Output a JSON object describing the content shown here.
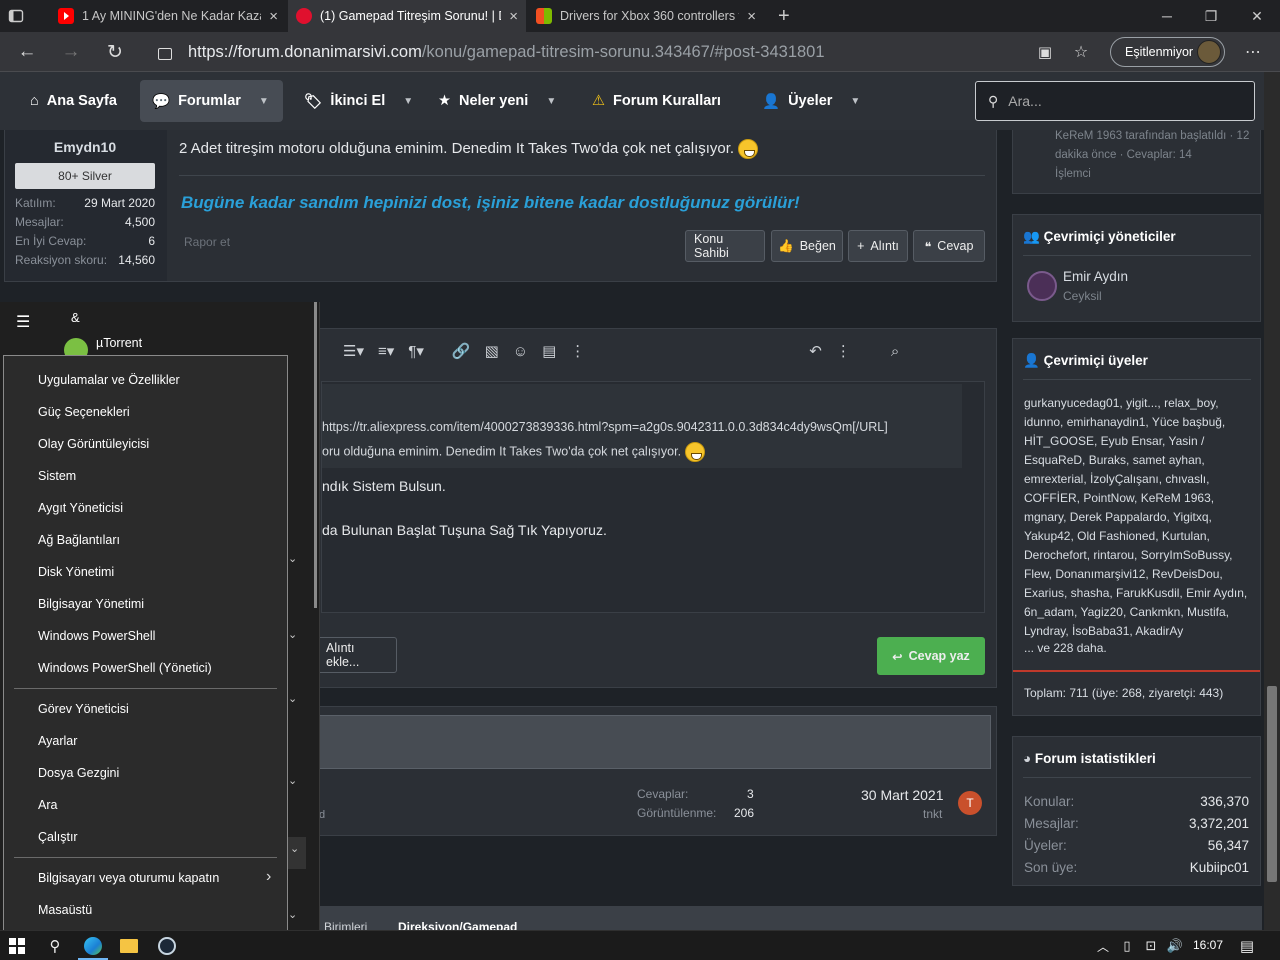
{
  "tabs": [
    {
      "title": "1 Ay MINING'den Ne Kadar Kaza",
      "close": "×",
      "favicon": "#ff0000"
    },
    {
      "title": "(1) Gamepad Titreşim Sorunu! | D",
      "close": "×",
      "favicon": "#e0102e"
    },
    {
      "title": "Drivers for Xbox 360 controllers f",
      "close": "×",
      "favicon": "#00a4ef"
    }
  ],
  "new_tab": "+",
  "window": {
    "minimize": "─",
    "maximize": "❐",
    "close": "✕"
  },
  "address": {
    "host": "https://forum.donanimarsivi.com",
    "path": "/konu/gamepad-titresim-sorunu.343467/#post-3431801",
    "sync_label": "Eşitlenmiyor"
  },
  "nav": {
    "home": "Ana Sayfa",
    "forums": "Forumlar",
    "second_hand": "İkinci El",
    "whats_new": "Neler yeni",
    "rules": "Forum Kuralları",
    "members": "Üyeler",
    "search_placeholder": "Ara..."
  },
  "post": {
    "author": "Emydn10",
    "badge": "80+ Silver",
    "stats": [
      {
        "k": "Katılım:",
        "v": "29 Mart 2020"
      },
      {
        "k": "Mesajlar:",
        "v": "4,500"
      },
      {
        "k": "En İyi Cevap:",
        "v": "6"
      },
      {
        "k": "Reaksiyon skoru:",
        "v": "14,560"
      }
    ],
    "text": "2 Adet titreşim motoru olduğuna eminim. Denedim It Takes Two'da çok net çalışıyor.",
    "signature": "Bugüne kadar sandım hepinizi dost, işiniz bitene kadar dostluğunuz görülür!",
    "report": "Rapor et",
    "btn_owner": "Konu Sahibi",
    "btn_like": "Beğen",
    "btn_quote": "Alıntı",
    "btn_reply": "Cevap"
  },
  "editor": {
    "quote_line1": "https://tr.aliexpress.com/item/4000273839336.html?spm=a2g0s.9042311.0.0.3d834c4dy9wsQm[/URL]",
    "quote_line2": "oru olduğuna eminim. Denedim It Takes Two'da çok net çalışıyor.",
    "line3": "ndık Sistem Bulsun.",
    "line4": "da Bulunan Başlat Tuşuna Sağ Tık Yapıyoruz.",
    "insert_quote": "Alıntı ekle...",
    "reply_btn": "Cevap yaz"
  },
  "similar": {
    "replies_label": "Cevaplar:",
    "replies": "3",
    "views_label": "Görüntülenme:",
    "views": "206",
    "date": "30 Mart 2021",
    "user": "tnkt",
    "avatar_letter": "T",
    "fragment": "d"
  },
  "breadcrumb": {
    "a": "Birimleri",
    "b": "Direksiyon/Gamepad"
  },
  "sidebar": {
    "latest_text": "KeReM 1963 tarafından başlatıldı · 12 dakika önce · Cevaplar: 14",
    "latest_forum": "İşlemci",
    "staff_title": "Çevrimiçi yöneticiler",
    "staff_name": "Emir Aydın",
    "staff_role": "Ceyksil",
    "online_title": "Çevrimiçi üyeler",
    "online_list": "gurkanyucedag01, yigit..., relax_boy, idunno, emirhanaydin1, Yüce başbuğ, HİT_GOOSE, Eyub Ensar, Yasin / EsquaReD, Buraks, samet ayhan, emrexterial, İzolyÇalışanı, chıvaslı, COFFİER, PointNow, KeReM 1963, mgnary, Derek Pappalardo, Yigitxq, Yakup42, Old Fashioned, Kurtulan, Derochefort, rintarou, SorryImSoBussy, Flew, Donanımarşivi12, RevDeisDou, Exarius, shasha, FarukKusdil, Emir Aydın, 6n_adam, Yagiz20, Cankmkn, Mustifa, Lyndray, İsoBaba31, AkadirAy",
    "online_more": "... ve 228 daha.",
    "online_total": "Toplam: 711 (üye: 268, ziyaretçi: 443)",
    "stats_title": "Forum istatistikleri",
    "stats": [
      {
        "k": "Konular:",
        "v": "336,370"
      },
      {
        "k": "Mesajlar:",
        "v": "3,372,201"
      },
      {
        "k": "Üyeler:",
        "v": "56,347"
      },
      {
        "k": "Son üye:",
        "v": "Kubiipc01"
      }
    ]
  },
  "startmenu": {
    "ampersand": "&",
    "app": "µTorrent"
  },
  "context_menu": [
    "Uygulamalar ve Özellikler",
    "Güç Seçenekleri",
    "Olay Görüntüleyicisi",
    "Sistem",
    "Aygıt Yöneticisi",
    "Ağ Bağlantıları",
    "Disk Yönetimi",
    "Bilgisayar Yönetimi",
    "Windows PowerShell",
    "Windows PowerShell (Yönetici)",
    "Görev Yöneticisi",
    "Ayarlar",
    "Dosya Gezgini",
    "Ara",
    "Çalıştır",
    "Bilgisayarı veya oturumu kapatın",
    "Masaüstü"
  ],
  "taskbar": {
    "time": "16:07"
  }
}
